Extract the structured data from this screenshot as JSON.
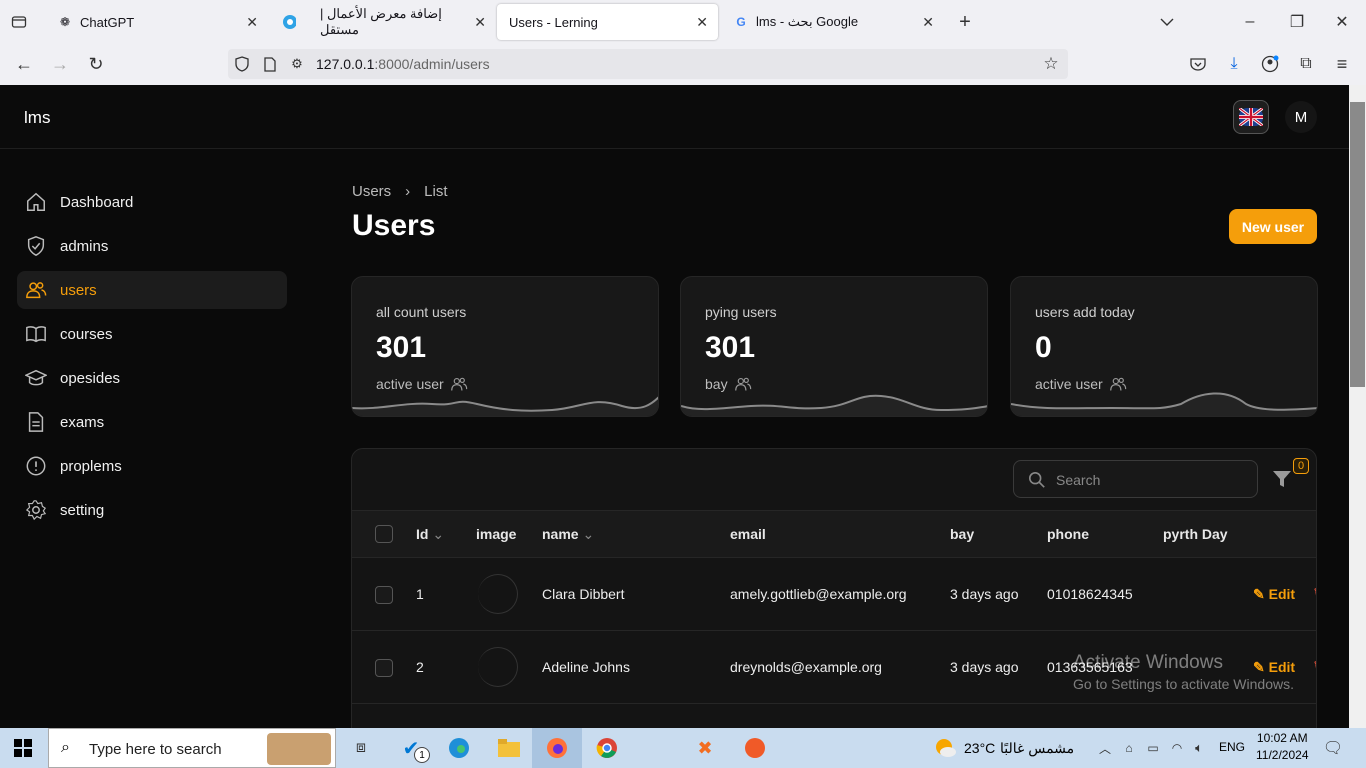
{
  "browser": {
    "tabs": [
      {
        "title": "ChatGPT",
        "icon": "chatgpt-icon"
      },
      {
        "title": "إضافة معرض الأعمال | مستقل",
        "icon": "mostaql-icon"
      },
      {
        "title": "Users - Lerning",
        "icon": ""
      },
      {
        "title": "lms - بحث Google",
        "icon": "google-icon"
      }
    ],
    "url_host": "127.0.0.1",
    "url_rest": ":8000/admin/users"
  },
  "app": {
    "brand": "lms",
    "avatar_initial": "M",
    "sidebar": [
      {
        "label": "Dashboard",
        "icon": "home-icon"
      },
      {
        "label": "admins",
        "icon": "shield-check-icon"
      },
      {
        "label": "users",
        "icon": "users-icon",
        "active": true
      },
      {
        "label": "courses",
        "icon": "book-icon"
      },
      {
        "label": "opesides",
        "icon": "academic-cap-icon"
      },
      {
        "label": "exams",
        "icon": "document-icon"
      },
      {
        "label": "proplems",
        "icon": "exclamation-icon"
      },
      {
        "label": "setting",
        "icon": "gear-icon"
      }
    ],
    "breadcrumb": {
      "parent": "Users",
      "current": "List"
    },
    "page_title": "Users",
    "new_user_label": "New user",
    "stats": [
      {
        "title": "all count users",
        "value": "301",
        "desc": "active user"
      },
      {
        "title": "pying users",
        "value": "301",
        "desc": "bay"
      },
      {
        "title": "users add today",
        "value": "0",
        "desc": "active user"
      }
    ],
    "search_placeholder": "Search",
    "filter_count": "0",
    "columns": [
      "Id",
      "image",
      "name",
      "email",
      "bay",
      "phone",
      "pyrth Day"
    ],
    "rows": [
      {
        "id": "1",
        "name": "Clara Dibbert",
        "email": "amely.gottlieb@example.org",
        "bay": "3 days ago",
        "phone": "01018624345",
        "edit": "Edit"
      },
      {
        "id": "2",
        "name": "Adeline Johns",
        "email": "dreynolds@example.org",
        "bay": "3 days ago",
        "phone": "01363565163",
        "edit": "Edit"
      }
    ]
  },
  "watermark": {
    "line1": "Activate Windows",
    "line2": "Go to Settings to activate Windows."
  },
  "taskbar": {
    "search_placeholder": "Type here to search",
    "weather_temp": "23°C",
    "weather_desc": "مشمس غالبًا",
    "lang": "ENG",
    "time": "10:02 AM",
    "date": "11/2/2024",
    "badge": "1"
  },
  "colors": {
    "accent": "#f59e0b",
    "bg": "#0a0a0a",
    "card": "#181818"
  }
}
